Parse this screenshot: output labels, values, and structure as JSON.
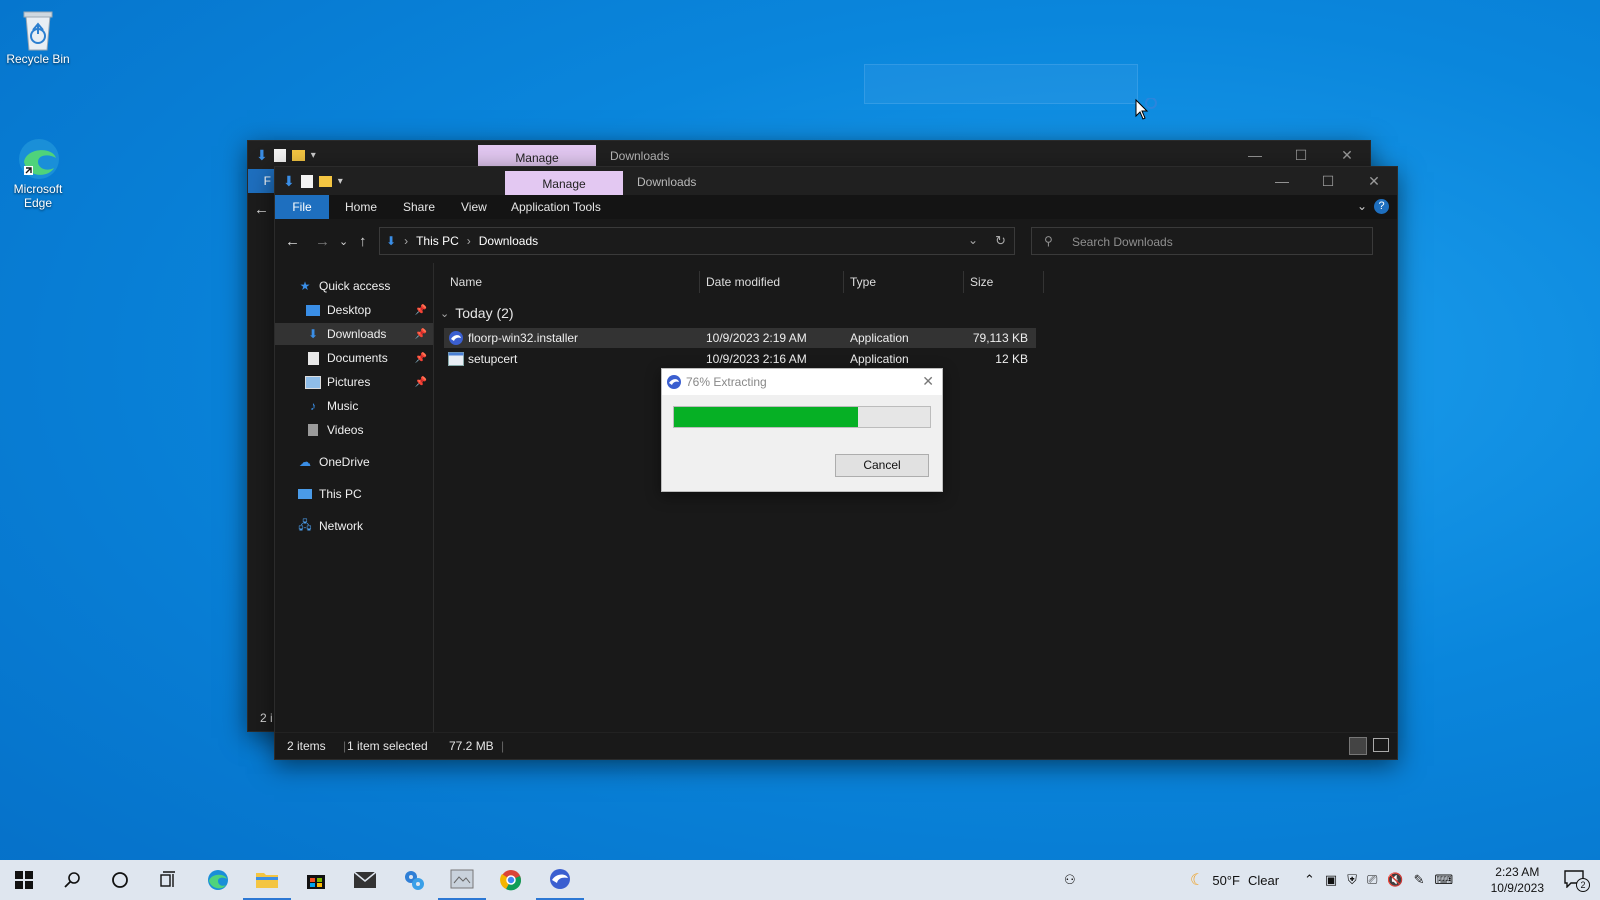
{
  "desktop": {
    "icons": [
      {
        "label": "Recycle Bin"
      },
      {
        "label": "Microsoft\nEdge"
      }
    ]
  },
  "back_window": {
    "manage_label": "Manage",
    "title": "Downloads",
    "ribbon_file_fragment": "F",
    "status_fragment": "2 i"
  },
  "window": {
    "manage_label": "Manage",
    "title": "Downloads",
    "ribbon_tabs": [
      "File",
      "Home",
      "Share",
      "View",
      "Application Tools"
    ],
    "breadcrumb": [
      "This PC",
      "Downloads"
    ],
    "search_placeholder": "Search Downloads",
    "nav": {
      "quick_access": "Quick access",
      "pinned": [
        "Desktop",
        "Downloads",
        "Documents",
        "Pictures"
      ],
      "unpinned": [
        "Music",
        "Videos"
      ],
      "onedrive": "OneDrive",
      "this_pc": "This PC",
      "network": "Network"
    },
    "columns": [
      "Name",
      "Date modified",
      "Type",
      "Size"
    ],
    "group": "Today (2)",
    "files": [
      {
        "name": "floorp-win32.installer",
        "date": "10/9/2023 2:19 AM",
        "type": "Application",
        "size": "79,113 KB"
      },
      {
        "name": "setupcert",
        "date": "10/9/2023 2:16 AM",
        "type": "Application",
        "size": "12 KB"
      }
    ],
    "status": {
      "items": "2 items",
      "selected": "1 item selected",
      "size": "77.2 MB"
    }
  },
  "dialog": {
    "title": "76% Extracting",
    "progress_percent": 72,
    "cancel_label": "Cancel"
  },
  "taskbar": {
    "weather_temp": "50°F",
    "weather_desc": "Clear",
    "time": "2:23 AM",
    "date": "10/9/2023",
    "notification_count": "2"
  },
  "colors": {
    "accent": "#1e6fbf",
    "manage_tab": "#e3c8f2",
    "progress_fill": "#06b025"
  }
}
